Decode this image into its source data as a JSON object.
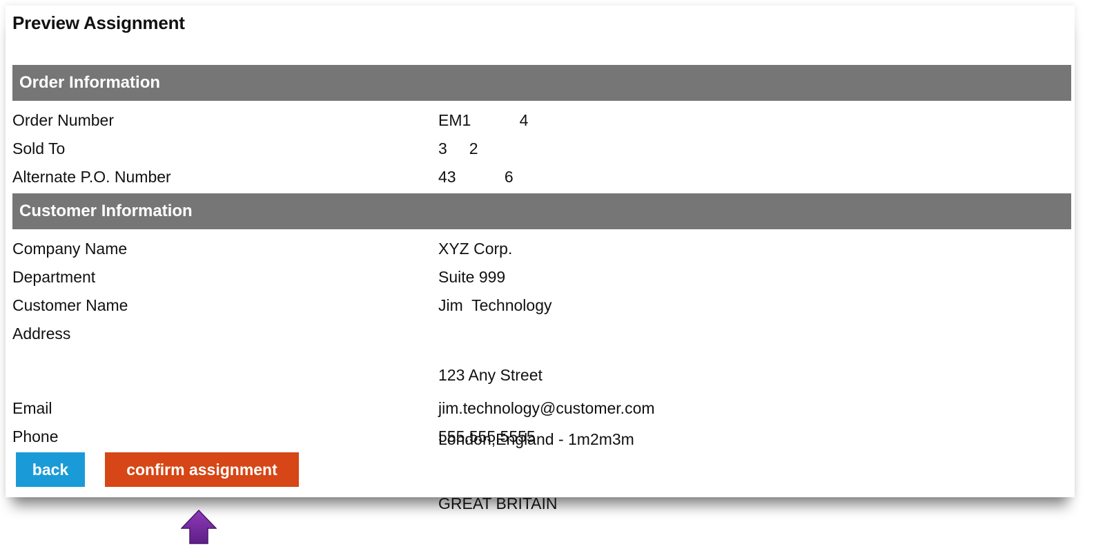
{
  "page_title": "Preview Assignment",
  "order_section": {
    "header": "Order Information",
    "rows": [
      {
        "label": "Order Number",
        "value": "EM1           4"
      },
      {
        "label": "Sold To",
        "value": "3     2"
      },
      {
        "label": "Alternate P.O. Number",
        "value": "43           6"
      }
    ]
  },
  "customer_section": {
    "header": "Customer Information",
    "company": {
      "label": "Company Name",
      "value": "XYZ Corp."
    },
    "department": {
      "label": "Department",
      "value": "Suite 999"
    },
    "customer_name": {
      "label": "Customer Name",
      "value": "Jim  Technology"
    },
    "address": {
      "label": "Address",
      "lines": [
        "123 Any Street",
        "London,England - 1m2m3m",
        "GREAT BRITAIN"
      ]
    },
    "email": {
      "label": "Email",
      "value": "jim.technology@customer.com"
    },
    "phone": {
      "label": "Phone",
      "value": "555.555.5555"
    }
  },
  "buttons": {
    "back_label": "back",
    "confirm_label": "confirm assignment"
  },
  "colors": {
    "section_header_bg": "#767676",
    "back_button": "#1a9bd7",
    "confirm_button": "#d64616",
    "pointer_arrow": "#7a2fa0"
  },
  "icons": {
    "pointer": "up-arrow-icon"
  }
}
